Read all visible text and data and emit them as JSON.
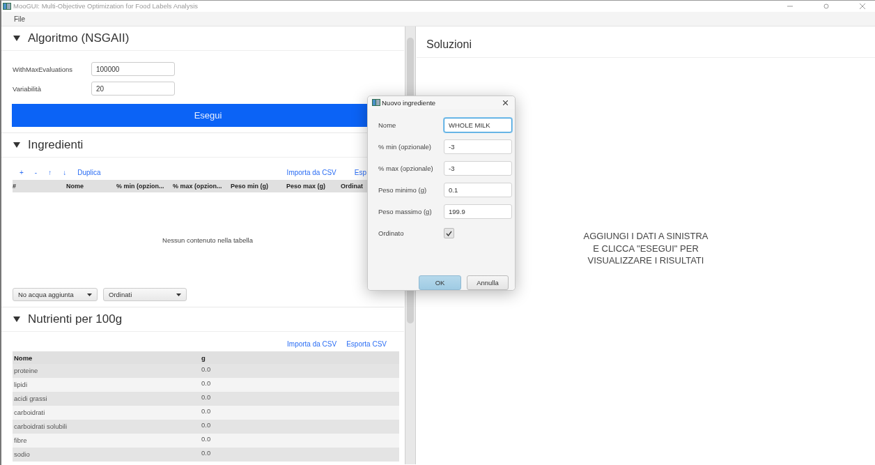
{
  "window": {
    "title": "MooGUI: Multi-Objective Optimization for Food Labels Analysis"
  },
  "menu": [
    {
      "label": "File"
    }
  ],
  "algorithm": {
    "title": "Algoritmo (NSGAII)",
    "expanded": true,
    "fields": [
      {
        "label": "WithMaxEvaluations",
        "value": "100000"
      },
      {
        "label": "Variabilità",
        "value": "20"
      }
    ],
    "run_button": "Esegui"
  },
  "ingredients": {
    "title": "Ingredienti",
    "expanded": true,
    "toolbar": [
      "+",
      "-",
      "↑",
      "↓",
      "Duplica"
    ],
    "links": [
      "Importa da CSV",
      "Esp"
    ],
    "columns": [
      "#",
      "Nome",
      "% min (opzion...",
      "% max (opzion...",
      "Peso min (g)",
      "Peso max (g)",
      "Ordinat"
    ],
    "empty_text": "Nessun contenuto nella tabella",
    "dropdowns": [
      {
        "value": "No acqua aggiunta"
      },
      {
        "value": "Ordinati"
      }
    ]
  },
  "nutrients": {
    "title": "Nutrienti per 100g",
    "expanded": true,
    "links": [
      "Importa da CSV",
      "Esporta CSV"
    ],
    "columns": [
      "Nome",
      "g"
    ],
    "rows": [
      {
        "name": "proteine",
        "value": "0.0"
      },
      {
        "name": "lipidi",
        "value": "0.0"
      },
      {
        "name": "acidi grassi",
        "value": "0.0"
      },
      {
        "name": "carboidrati",
        "value": "0.0"
      },
      {
        "name": "carboidrati solubili",
        "value": "0.0"
      },
      {
        "name": "fibre",
        "value": "0.0"
      },
      {
        "name": "sodio",
        "value": "0.0"
      }
    ]
  },
  "solutions": {
    "title": "Soluzioni",
    "message": "AGGIUNGI I DATI A SINISTRA\nE CLICCA \"ESEGUI\" PER\nVISUALIZZARE I RISULTATI"
  },
  "dialog": {
    "title": "Nuovo ingrediente",
    "fields": [
      {
        "label": "Nome",
        "value": "WHOLE MILK",
        "focused": true
      },
      {
        "label": "% min (opzionale)",
        "value": "-3",
        "focused": false
      },
      {
        "label": "% max (opzionale)",
        "value": "-3",
        "focused": false
      },
      {
        "label": "Peso minimo (g)",
        "value": "0.1",
        "focused": false
      },
      {
        "label": "Peso massimo (g)",
        "value": "199.9",
        "focused": false
      }
    ],
    "checkbox": {
      "label": "Ordinato",
      "checked": true
    },
    "buttons": [
      {
        "label": "OK",
        "default": true
      },
      {
        "label": "Annulla",
        "default": false
      }
    ]
  }
}
